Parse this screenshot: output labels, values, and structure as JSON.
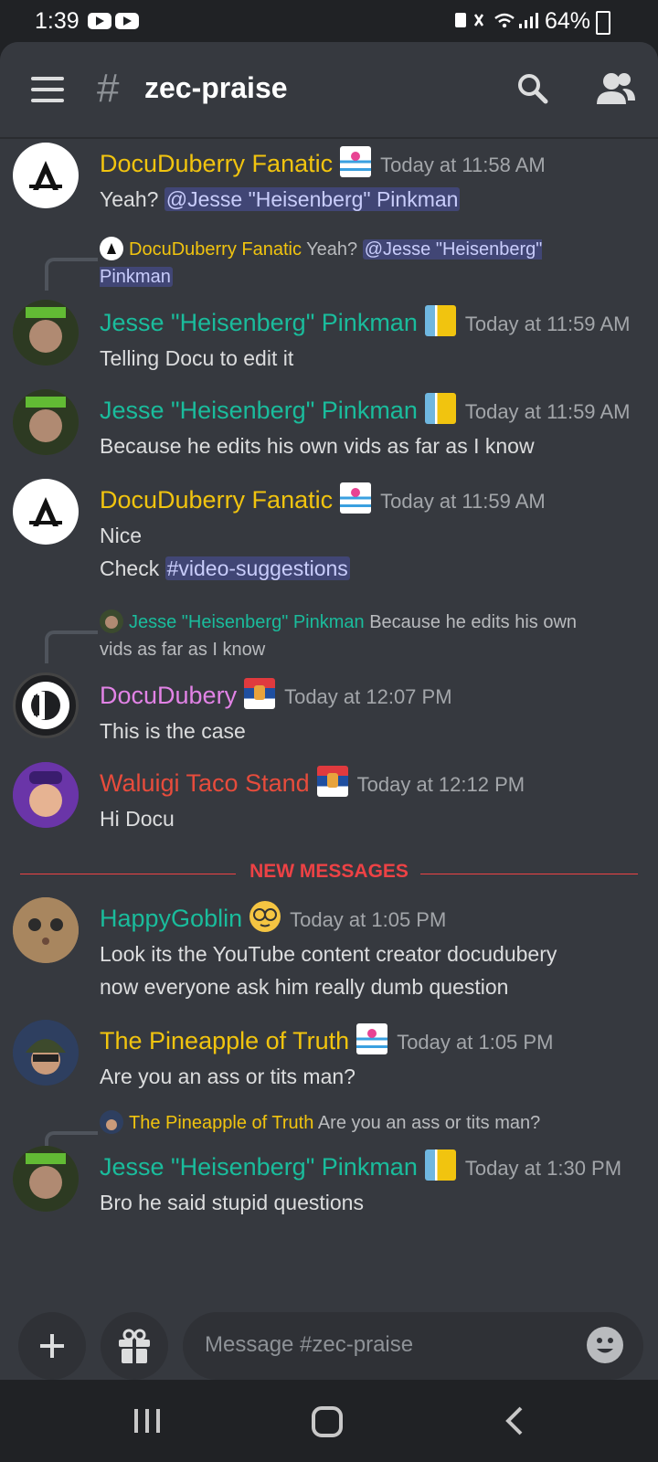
{
  "status": {
    "time": "1:39",
    "battery": "64%"
  },
  "header": {
    "hash": "#",
    "channel": "zec-praise"
  },
  "messages": [
    {
      "author": "DocuDuberry Fanatic",
      "timestamp": "Today at 11:58 AM",
      "lines": [
        "Yeah?"
      ],
      "mention": "@Jesse \"Heisenberg\" Pinkman",
      "color": "#f1c40f"
    },
    {
      "reply_to": "DocuDuberry Fanatic",
      "reply_text": "Yeah?",
      "reply_mention": "@Jesse \"Heisenberg\" Pinkman",
      "author": "Jesse \"Heisenberg\" Pinkman",
      "timestamp": "Today at 11:59 AM",
      "lines": [
        "Telling Docu to edit it"
      ],
      "color": "#1abc9c"
    },
    {
      "author": "Jesse \"Heisenberg\" Pinkman",
      "timestamp": "Today at 11:59 AM",
      "lines": [
        "Because he edits his own vids as far as I know"
      ],
      "color": "#1abc9c"
    },
    {
      "author": "DocuDuberry Fanatic",
      "timestamp": "Today at 11:59 AM",
      "lines": [
        "Nice",
        "Check"
      ],
      "channel_mention": "#video-suggestions",
      "color": "#f1c40f"
    },
    {
      "reply_to": "Jesse \"Heisenberg\" Pinkman",
      "reply_text": "Because he edits his own vids as far as I know",
      "author": "DocuDubery",
      "timestamp": "Today at 12:07 PM",
      "lines": [
        "This is the case"
      ],
      "color": "#e283e6"
    },
    {
      "author": "Waluigi Taco Stand",
      "timestamp": "Today at 12:12 PM",
      "lines": [
        "Hi Docu"
      ],
      "color": "#e74c3c"
    },
    {
      "author": "HappyGoblin",
      "timestamp": "Today at 1:05 PM",
      "lines": [
        "Look its the YouTube content creator docudubery",
        "now everyone ask him really dumb question"
      ],
      "color": "#1abc9c"
    },
    {
      "author": "The Pineapple of Truth",
      "timestamp": "Today at 1:05 PM",
      "lines": [
        "Are you an ass or tits man?"
      ],
      "color": "#f1c40f"
    },
    {
      "reply_to": "The Pineapple of Truth",
      "reply_text": "Are you an ass or tits man?",
      "author": "Jesse \"Heisenberg\" Pinkman",
      "timestamp": "Today at 1:30 PM",
      "lines": [
        "Bro he said stupid questions"
      ],
      "color": "#1abc9c"
    }
  ],
  "divider": {
    "label": "NEW MESSAGES"
  },
  "composer": {
    "placeholder": "Message #zec-praise"
  },
  "icons": [
    "menu-icon",
    "search-icon",
    "members-icon",
    "plus-icon",
    "gift-icon",
    "emoji-icon",
    "recents-icon",
    "home-icon",
    "back-icon"
  ]
}
